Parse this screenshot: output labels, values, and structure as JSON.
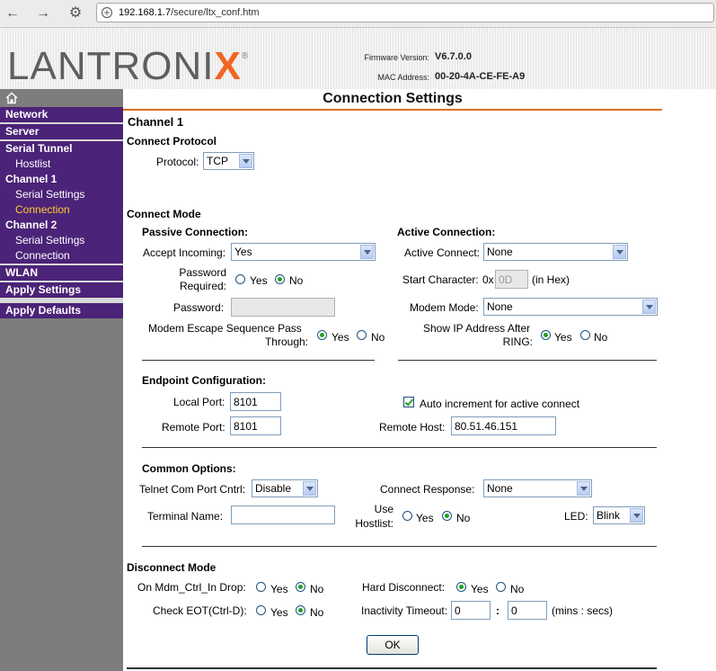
{
  "browser": {
    "url_host": "192.168.1.7",
    "url_path": "/secure/ltx_conf.htm"
  },
  "header": {
    "logo_main": "LANTRONI",
    "logo_x": "X",
    "logo_reg": "®",
    "firmware_label": "Firmware Version:",
    "firmware_value": "V6.7.0.0",
    "mac_label": "MAC Address:",
    "mac_value": "00-20-4A-CE-FE-A9"
  },
  "sidebar": {
    "items": [
      {
        "label": "Network"
      },
      {
        "label": "Server"
      },
      {
        "label": "Serial Tunnel"
      },
      {
        "label": "Hostlist"
      },
      {
        "label": "Channel 1"
      },
      {
        "label": "Serial Settings"
      },
      {
        "label": "Connection"
      },
      {
        "label": "Channel 2"
      },
      {
        "label": "Serial Settings"
      },
      {
        "label": "Connection"
      },
      {
        "label": "WLAN"
      },
      {
        "label": "Apply Settings"
      },
      {
        "label": "Apply Defaults"
      }
    ]
  },
  "page": {
    "title": "Connection Settings",
    "channel": "Channel 1",
    "connect_protocol": {
      "heading": "Connect Protocol",
      "protocol_label": "Protocol:",
      "protocol_value": "TCP"
    },
    "connect_mode": {
      "heading": "Connect Mode",
      "passive": {
        "heading": "Passive Connection:",
        "accept_incoming_label": "Accept Incoming:",
        "accept_incoming_value": "Yes",
        "password_required_label_1": "Password",
        "password_required_label_2": "Required:",
        "password_label": "Password:",
        "password_value": "",
        "modem_escape_label_1": "Modem Escape Sequence Pass",
        "modem_escape_label_2": "Through:"
      },
      "active": {
        "heading": "Active Connection:",
        "active_connect_label": "Active Connect:",
        "active_connect_value": "None",
        "start_char_label": "Start Character:",
        "start_char_prefix": "0x",
        "start_char_value": "0D",
        "start_char_suffix": "(in Hex)",
        "modem_mode_label": "Modem Mode:",
        "modem_mode_value": "None",
        "show_ip_label_1": "Show IP Address After",
        "show_ip_label_2": "RING:"
      },
      "yes": "Yes",
      "no": "No"
    },
    "endpoint": {
      "heading": "Endpoint Configuration:",
      "local_port_label": "Local Port:",
      "local_port_value": "8101",
      "auto_increment_label": "Auto increment for active connect",
      "remote_port_label": "Remote Port:",
      "remote_port_value": "8101",
      "remote_host_label": "Remote Host:",
      "remote_host_value": "80.51.46.151"
    },
    "common": {
      "heading": "Common Options:",
      "telnet_label": "Telnet Com Port Cntrl:",
      "telnet_value": "Disable",
      "connect_response_label": "Connect Response:",
      "connect_response_value": "None",
      "terminal_name_label": "Terminal Name:",
      "terminal_name_value": "",
      "use_hostlist_label_1": "Use",
      "use_hostlist_label_2": "Hostlist:",
      "led_label": "LED:",
      "led_value": "Blink"
    },
    "disconnect": {
      "heading": "Disconnect Mode",
      "mdm_ctrl_label": "On Mdm_Ctrl_In Drop:",
      "hard_disconnect_label": "Hard Disconnect:",
      "check_eot_label": "Check EOT(Ctrl-D):",
      "inactivity_label": "Inactivity Timeout:",
      "inactivity_min": "0",
      "inactivity_sep": ":",
      "inactivity_sec": "0",
      "inactivity_unit": "(mins : secs)"
    },
    "ok_label": "OK"
  }
}
